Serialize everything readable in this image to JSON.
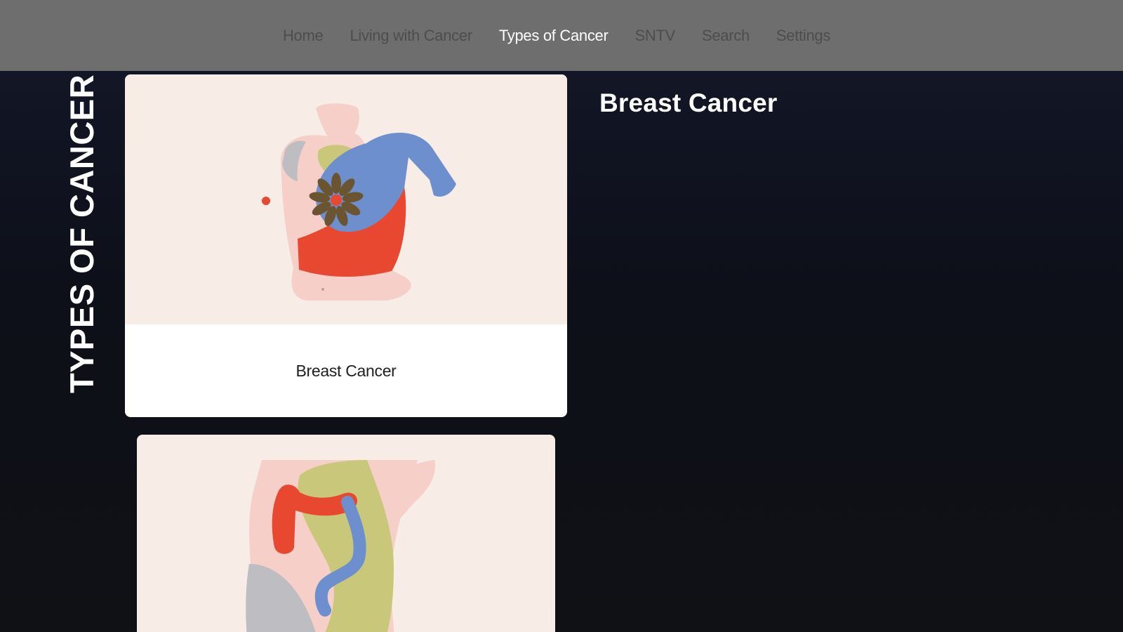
{
  "nav": {
    "items": [
      {
        "label": "Home"
      },
      {
        "label": "Living with Cancer"
      },
      {
        "label": "Types of Cancer"
      },
      {
        "label": "SNTV"
      },
      {
        "label": "Search"
      },
      {
        "label": "Settings"
      }
    ],
    "active": "Types of Cancer"
  },
  "section": {
    "title": "TYPES OF CANCER"
  },
  "cards": [
    {
      "label": "Breast Cancer",
      "illustration": "breast-illustration"
    },
    {
      "label": "",
      "illustration": "colon-illustration"
    }
  ],
  "detail": {
    "title": "Breast Cancer"
  },
  "colors": {
    "nav_background": "#6e6e6e",
    "nav_text": "#4d4d4d",
    "nav_active_text": "#ffffff",
    "page_background": "#0f121c",
    "card_art_background": "#f8ece6",
    "accent_red": "#e8482f",
    "accent_blue": "#6d8fce",
    "accent_olive": "#c9c77a",
    "accent_brown": "#6b5530"
  }
}
